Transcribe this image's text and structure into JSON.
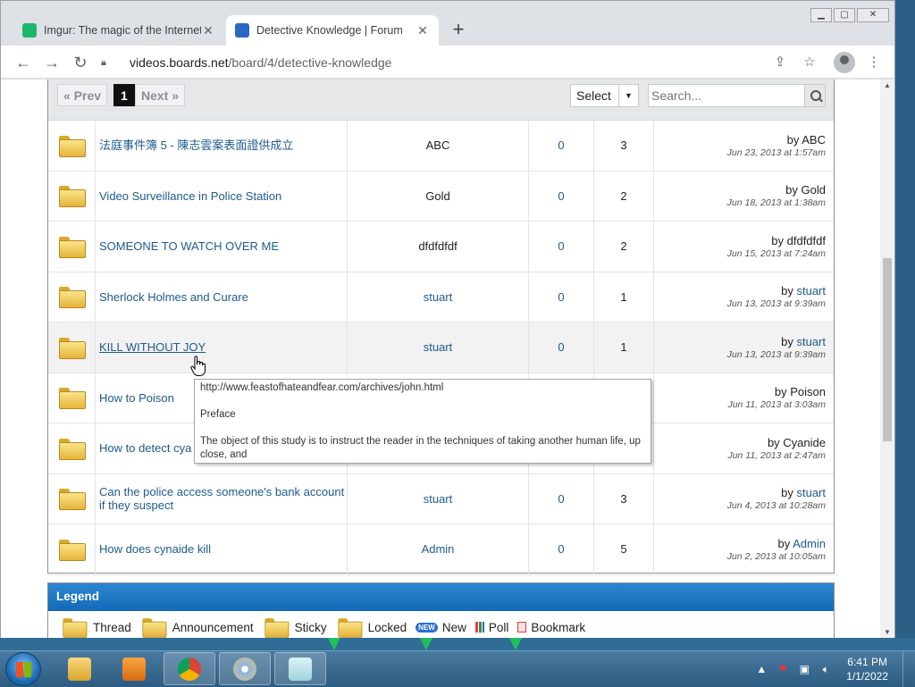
{
  "browser": {
    "tabs": [
      {
        "title": "Imgur: The magic of the Internet",
        "active": false,
        "favicon_color": "#1bb76e"
      },
      {
        "title": "Detective Knowledge | Forum",
        "active": true,
        "favicon_color": "#2a66c2"
      }
    ],
    "url_host": "videos.boards.net",
    "url_path": "/board/4/detective-knowledge"
  },
  "pager": {
    "prev": "« Prev",
    "current": "1",
    "next": "Next »",
    "select_label": "Select",
    "search_placeholder": "Search..."
  },
  "threads": [
    {
      "title": "法庭事件簿 5 - 陳志雲案表面證供成立",
      "starter": "ABC",
      "starter_link": false,
      "replies": "0",
      "views": "3",
      "last_by": "ABC",
      "last_link": false,
      "last_date": "Jun 23, 2013 at 1:57am"
    },
    {
      "title": "Video Surveillance in Police Station",
      "starter": "Gold",
      "starter_link": false,
      "replies": "0",
      "views": "2",
      "last_by": "Gold",
      "last_link": false,
      "last_date": "Jun 18, 2013 at 1:38am"
    },
    {
      "title": "SOMEONE TO WATCH OVER ME",
      "starter": "dfdfdfdf",
      "starter_link": false,
      "replies": "0",
      "views": "2",
      "last_by": "dfdfdfdf",
      "last_link": false,
      "last_date": "Jun 15, 2013 at 7:24am"
    },
    {
      "title": "Sherlock Holmes and Curare",
      "starter": "stuart",
      "starter_link": true,
      "replies": "0",
      "views": "1",
      "last_by": "stuart",
      "last_link": true,
      "last_date": "Jun 13, 2013 at 9:39am"
    },
    {
      "title": "KILL WITHOUT JOY",
      "starter": "stuart",
      "starter_link": true,
      "replies": "0",
      "views": "1",
      "last_by": "stuart",
      "last_link": true,
      "last_date": "Jun 13, 2013 at 9:39am"
    },
    {
      "title": "How to Poison",
      "starter": "",
      "starter_link": false,
      "replies": "",
      "views": "",
      "last_by": "Poison",
      "last_link": false,
      "last_date": "Jun 11, 2013 at 3:03am"
    },
    {
      "title": "How to detect cya",
      "starter": "",
      "starter_link": false,
      "replies": "",
      "views": "",
      "last_by": "Cyanide",
      "last_link": false,
      "last_date": "Jun 11, 2013 at 2:47am"
    },
    {
      "title": "Can the police access someone's bank account if they suspect",
      "starter": "stuart",
      "starter_link": true,
      "replies": "0",
      "views": "3",
      "last_by": "stuart",
      "last_link": true,
      "last_date": "Jun 4, 2013 at 10:28am"
    },
    {
      "title": "How does cynaide kill",
      "starter": "Admin",
      "starter_link": true,
      "replies": "0",
      "views": "5",
      "last_by": "Admin",
      "last_link": true,
      "last_date": "Jun 2, 2013 at 10:05am"
    }
  ],
  "by_prefix": "by",
  "tooltip": {
    "url": "http://www.feastofhateandfear.com/archives/john.html",
    "heading": "Preface",
    "body": "The object of this study is to instruct the reader in the techniques of taking another human life, up close, and"
  },
  "legend": {
    "title": "Legend",
    "items": [
      "Thread",
      "Announcement",
      "Sticky",
      "Locked",
      "New",
      "Poll",
      "Bookmark"
    ],
    "new_badge": "NEW"
  },
  "taskbar": {
    "time": "6:41 PM",
    "date": "1/1/2022"
  }
}
